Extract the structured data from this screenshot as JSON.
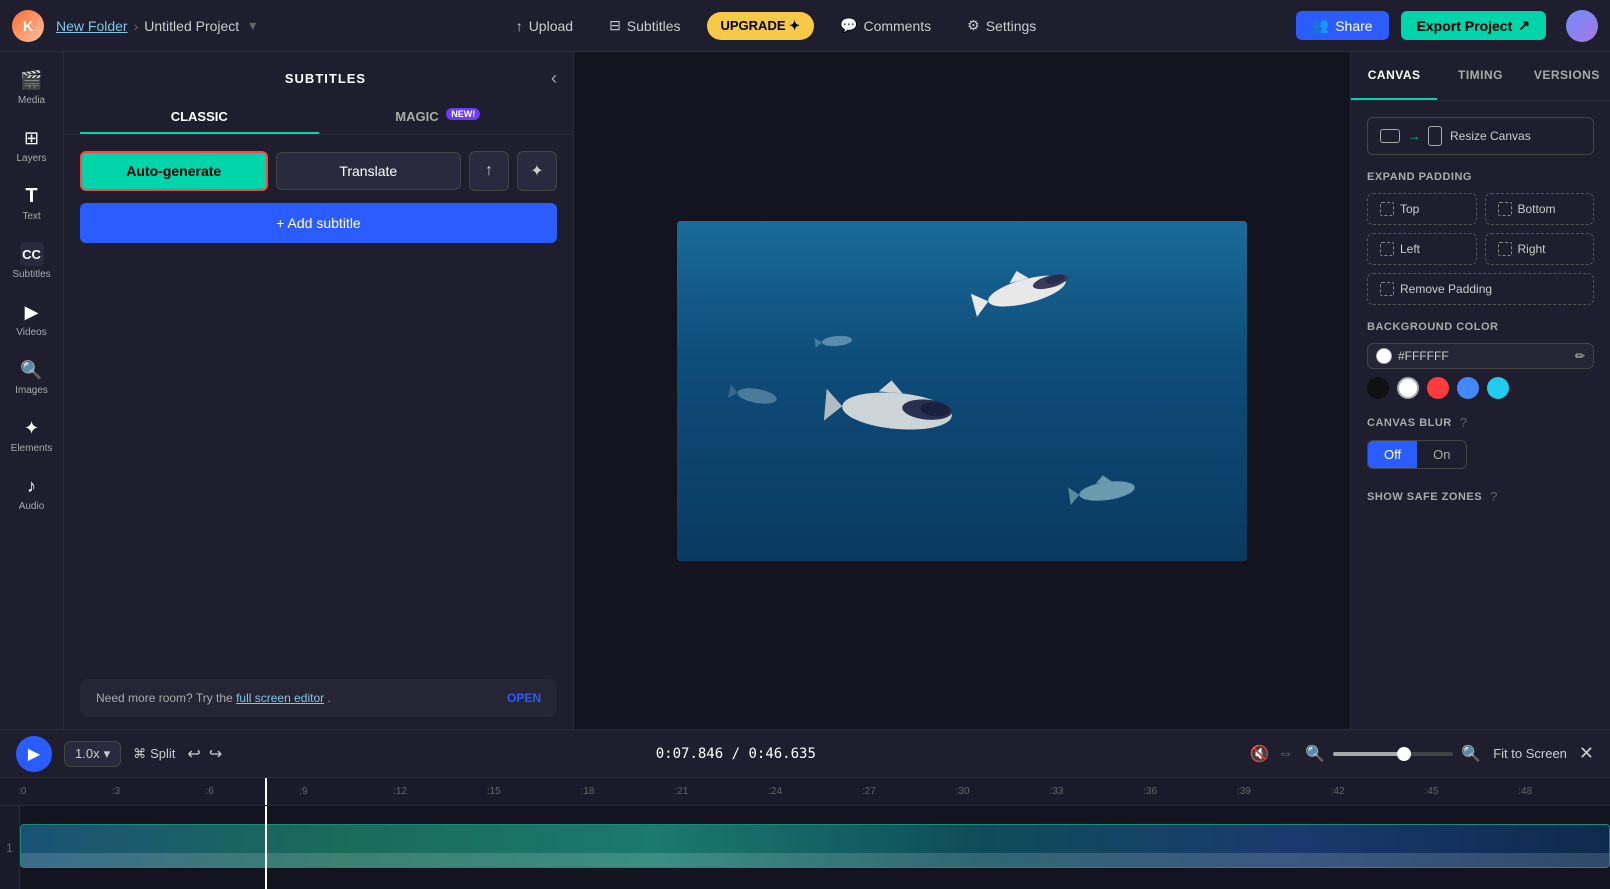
{
  "app": {
    "logo_text": "K",
    "breadcrumb": {
      "folder": "New Folder",
      "sep": "›",
      "project": "Untitled Project",
      "chevron": "▾"
    }
  },
  "topbar": {
    "upload_label": "Upload",
    "subtitles_label": "Subtitles",
    "upgrade_label": "UPGRADE ✦",
    "comments_label": "Comments",
    "settings_label": "Settings",
    "share_label": "Share",
    "export_label": "Export Project"
  },
  "left_sidebar": {
    "items": [
      {
        "id": "media",
        "icon": "🎬",
        "label": "Media"
      },
      {
        "id": "layers",
        "icon": "◫",
        "label": "Layers"
      },
      {
        "id": "text",
        "icon": "T",
        "label": "Text"
      },
      {
        "id": "subtitles",
        "icon": "CC",
        "label": "Subtitles"
      },
      {
        "id": "videos",
        "icon": "▶",
        "label": "Videos"
      },
      {
        "id": "images",
        "icon": "🔍",
        "label": "Images"
      },
      {
        "id": "elements",
        "icon": "✦",
        "label": "Elements"
      },
      {
        "id": "audio",
        "icon": "♪",
        "label": "Audio"
      }
    ]
  },
  "subtitles_panel": {
    "title": "SUBTITLES",
    "tabs": [
      {
        "id": "classic",
        "label": "CLASSIC",
        "active": true
      },
      {
        "id": "magic",
        "label": "MAGIC",
        "badge": "NEW!"
      }
    ],
    "auto_generate_label": "Auto-generate",
    "translate_label": "Translate",
    "add_subtitle_label": "+ Add subtitle",
    "need_more_room_text": "Need more room? Try the",
    "full_screen_link": "full screen editor",
    "need_more_room_suffix": ".",
    "open_label": "OPEN"
  },
  "right_panel": {
    "tabs": [
      {
        "id": "canvas",
        "label": "CANVAS",
        "active": true
      },
      {
        "id": "timing",
        "label": "TIMING"
      },
      {
        "id": "versions",
        "label": "VERSIONS"
      }
    ],
    "resize_canvas_label": "Resize Canvas",
    "expand_padding_label": "EXPAND PADDING",
    "expand_buttons": [
      {
        "id": "top",
        "label": "Top"
      },
      {
        "id": "bottom",
        "label": "Bottom"
      },
      {
        "id": "left",
        "label": "Left"
      },
      {
        "id": "right",
        "label": "Right"
      },
      {
        "id": "remove",
        "label": "Remove Padding",
        "full": true
      }
    ],
    "background_color_label": "BACKGROUND COLOR",
    "color_value": "#FFFFFF",
    "color_presets": [
      {
        "id": "black",
        "color": "#111111"
      },
      {
        "id": "white",
        "color": "#FFFFFF"
      },
      {
        "id": "red",
        "color": "#FF3B3B"
      },
      {
        "id": "blue",
        "color": "#4488FF"
      },
      {
        "id": "teal",
        "color": "#22CCEE"
      }
    ],
    "canvas_blur_label": "CANVAS BLUR",
    "blur_off_label": "Off",
    "blur_on_label": "On",
    "show_safe_zones_label": "SHOW SAFE ZONES"
  },
  "timeline": {
    "speed_label": "1.0x",
    "split_label": "Split",
    "time_current": "0:07.846",
    "time_total": "0:46.635",
    "fit_screen_label": "Fit to Screen",
    "ruler_marks": [
      ":0",
      ":3",
      ":6",
      ":9",
      ":12",
      ":15",
      ":18",
      ":21",
      ":24",
      ":27",
      ":30",
      ":33",
      ":36",
      ":39",
      ":42",
      ":45",
      ":48"
    ],
    "track_number": "1"
  }
}
